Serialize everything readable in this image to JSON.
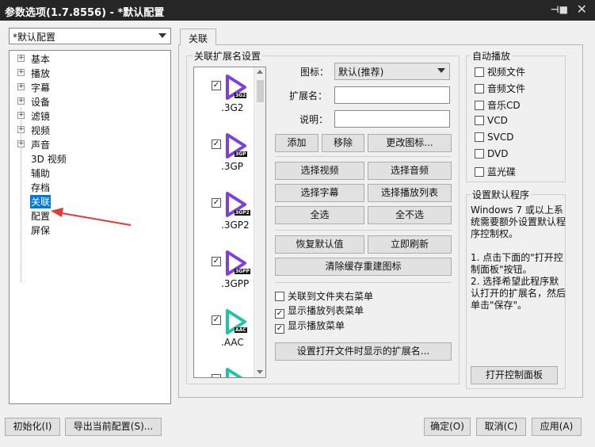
{
  "window": {
    "title": "参数选项(1.7.8556) - *默认配置"
  },
  "profile_select": {
    "value": "*默认配置"
  },
  "tree": [
    {
      "label": "基本",
      "expandable": true
    },
    {
      "label": "播放",
      "expandable": true
    },
    {
      "label": "字幕",
      "expandable": true
    },
    {
      "label": "设备",
      "expandable": true
    },
    {
      "label": "滤镜",
      "expandable": true
    },
    {
      "label": "视频",
      "expandable": true
    },
    {
      "label": "声音",
      "expandable": true
    },
    {
      "label": "3D 视频",
      "expandable": false
    },
    {
      "label": "辅助",
      "expandable": false
    },
    {
      "label": "存档",
      "expandable": false
    },
    {
      "label": "关联",
      "expandable": false,
      "selected": true
    },
    {
      "label": "配置",
      "expandable": false
    },
    {
      "label": "屏保",
      "expandable": false
    }
  ],
  "tab": {
    "label": "关联"
  },
  "assoc": {
    "group_title": "关联扩展名设置",
    "files": [
      {
        "ext": ".3G2",
        "tag": "3G2",
        "color": "#7b3fe4",
        "checked": true
      },
      {
        "ext": ".3GP",
        "tag": "3GP",
        "color": "#7b3fe4",
        "checked": true
      },
      {
        "ext": ".3GP2",
        "tag": "3GP2",
        "color": "#7b3fe4",
        "checked": true
      },
      {
        "ext": ".3GPP",
        "tag": "3GPP",
        "color": "#7b3fe4",
        "checked": true
      },
      {
        "ext": ".AAC",
        "tag": "AAC",
        "color": "#1fc4a8",
        "checked": true
      },
      {
        "ext": "",
        "tag": "",
        "color": "#1fc4a8",
        "checked": false
      }
    ],
    "icon_label": "图标：",
    "icon_value": "默认(推荐)",
    "ext_label": "扩展名：",
    "desc_label": "说明：",
    "btn_add": "添加",
    "btn_remove": "移除",
    "btn_change_icon": "更改图标...",
    "btn_sel_video": "选择视频",
    "btn_sel_audio": "选择音频",
    "btn_sel_sub": "选择字幕",
    "btn_sel_playlist": "选择播放列表",
    "btn_sel_all": "全选",
    "btn_sel_none": "全不选",
    "btn_restore": "恢复默认值",
    "btn_refresh": "立即刷新",
    "btn_clear_cache": "清除缓存重建图标",
    "chk_folder_menu": "关联到文件夹右菜单",
    "chk_playlist_menu": "显示播放列表菜单",
    "chk_play_menu": "显示播放菜单",
    "btn_set_ext": "设置打开文件时显示的扩展名..."
  },
  "autoplay": {
    "title": "自动播放",
    "items": [
      "视频文件",
      "音频文件",
      "音乐CD",
      "VCD",
      "SVCD",
      "DVD",
      "蓝光碟"
    ]
  },
  "default_prog": {
    "title": "设置默认程序",
    "desc1": "Windows 7 或以上系统需要额外设置默认程序控制权。",
    "desc2": "1. 点击下面的\"打开控制面板\"按钮。",
    "desc3": "2. 选择希望此程序默认打开的扩展名，然后单击\"保存\"。",
    "btn_open_cp": "打开控制面板"
  },
  "footer": {
    "btn_init": "初始化(I)",
    "btn_export": "导出当前配置(S)...",
    "btn_ok": "确定(O)",
    "btn_cancel": "取消(C)",
    "btn_apply": "应用(A)"
  }
}
